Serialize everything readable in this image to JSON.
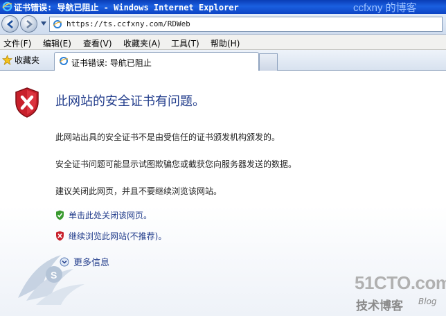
{
  "window": {
    "title": "证书错误: 导航已阻止 - Windows Internet Explorer",
    "watermark": "ccfxny 的博客"
  },
  "address_bar": {
    "url": "https://ts.ccfxny.com/RDWeb"
  },
  "menu": {
    "items": [
      {
        "label": "文件(F)"
      },
      {
        "label": "编辑(E)"
      },
      {
        "label": "查看(V)"
      },
      {
        "label": "收藏夹(A)"
      },
      {
        "label": "工具(T)"
      },
      {
        "label": "帮助(H)"
      }
    ]
  },
  "favorites": {
    "label": "收藏夹"
  },
  "tabs": [
    {
      "label": "证书错误: 导航已阻止"
    }
  ],
  "content": {
    "heading": "此网站的安全证书有问题。",
    "paragraphs": [
      "此网站出具的安全证书不是由受信任的证书颁发机构颁发的。",
      "安全证书问题可能显示试图欺骗您或截获您向服务器发送的数据。",
      "建议关闭此网页，并且不要继续浏览该网站。"
    ],
    "close_link": "单击此处关闭该网页。",
    "continue_link": "继续浏览此网站(不推荐)。",
    "more_info": "更多信息"
  },
  "watermarks": {
    "site": "51CTO.com",
    "tech_blog": "技术博客",
    "blog": "Blog"
  },
  "colors": {
    "titlebar": "#1a5fe0",
    "heading": "#1f3a8a",
    "shield_red": "#c8202b",
    "shield_green": "#3a9a2f"
  }
}
